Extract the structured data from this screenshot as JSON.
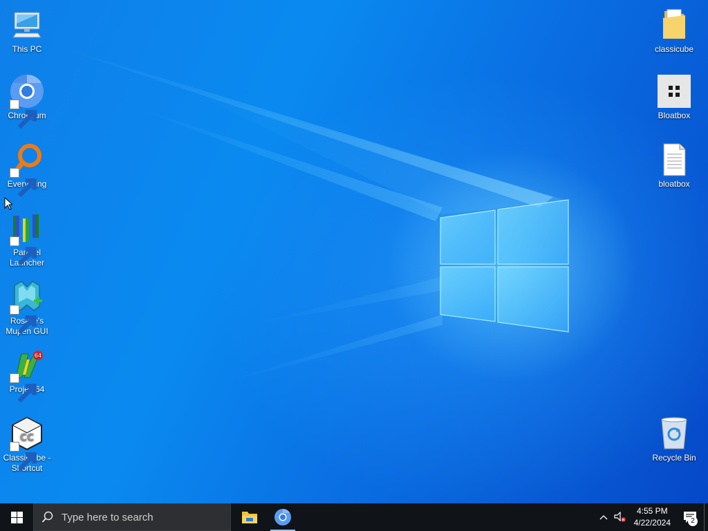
{
  "desktop": {
    "left_icons": [
      {
        "label_lines": [
          "This PC"
        ],
        "icon": "this-pc-icon",
        "shortcut": false
      },
      {
        "label_lines": [
          "Chromium"
        ],
        "icon": "chromium-icon",
        "shortcut": true
      },
      {
        "label_lines": [
          "Everything"
        ],
        "icon": "everything-search-icon",
        "shortcut": true
      },
      {
        "label_lines": [
          "Parallel",
          "Launcher"
        ],
        "icon": "parallel-launcher-icon",
        "shortcut": true
      },
      {
        "label_lines": [
          "Rosalie's",
          "Mupen GUI"
        ],
        "icon": "rosalies-mupen-gui-icon",
        "shortcut": true
      },
      {
        "label_lines": [
          "Project64"
        ],
        "icon": "project64-icon",
        "shortcut": true
      },
      {
        "label_lines": [
          "ClassiCube -",
          "Shortcut"
        ],
        "icon": "classicube-icon",
        "shortcut": true
      }
    ],
    "right_icons": [
      {
        "label_lines": [
          "classicube"
        ],
        "icon": "folder-icon"
      },
      {
        "label_lines": [
          "Bloatbox"
        ],
        "icon": "bloatbox-app-icon"
      },
      {
        "label_lines": [
          "bloatbox"
        ],
        "icon": "text-file-icon"
      },
      {
        "label_lines": [
          "Recycle Bin"
        ],
        "icon": "recycle-bin-icon"
      }
    ]
  },
  "taskbar": {
    "start_icon": "windows-start-icon",
    "search_placeholder": "Type here to search",
    "pinned_apps": [
      "file-explorer-icon",
      "chromium-icon"
    ],
    "tray": {
      "overflow_icon": "chevron-up-icon",
      "volume_icon": "volume-muted-icon",
      "time": "4:55 PM",
      "date": "4/22/2024",
      "notification_icon": "action-center-icon",
      "notification_count": "2"
    }
  },
  "colors": {
    "taskbar_bg": "#101418",
    "search_bg": "#2d2f33",
    "desktop_accent": "#0a7ae6"
  }
}
